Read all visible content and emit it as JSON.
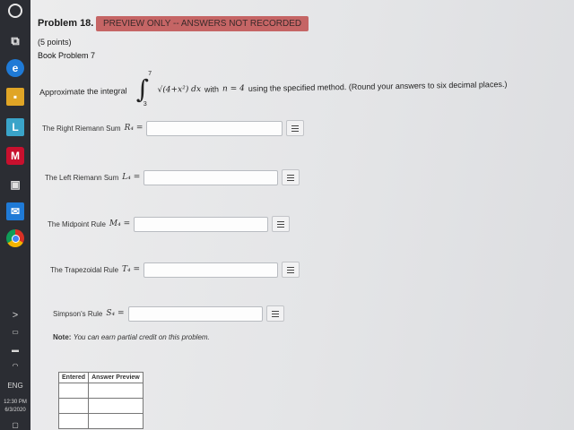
{
  "taskbar": {
    "lang": "ENG",
    "time": "12:30 PM",
    "date": "6/3/2020",
    "arrow": ">"
  },
  "problem": {
    "title": "Problem 18.",
    "badge": "PREVIEW ONLY -- ANSWERS NOT RECORDED",
    "points": "(5 points)",
    "book": "Book Problem 7",
    "intro": "Approximate the integral",
    "upper": "7",
    "lower": "3",
    "integrand": "√(4+x²) dx",
    "with_text": "with",
    "n_expr": "n = 4",
    "instructions": "using the specified method. (Round your answers to six decimal places.)"
  },
  "rules": [
    {
      "label": "The Right Riemann Sum",
      "sym": "R₄ ="
    },
    {
      "label": "The Left Riemann Sum",
      "sym": "L₄ ="
    },
    {
      "label": "The Midpoint Rule",
      "sym": "M₄ ="
    },
    {
      "label": "The Trapezoidal Rule",
      "sym": "T₄ ="
    },
    {
      "label": "Simpson's Rule",
      "sym": "S₄ ="
    }
  ],
  "note": {
    "prefix": "Note:",
    "text": "You can earn partial credit on this problem."
  },
  "table": {
    "headers": [
      "Entered",
      "Answer Preview"
    ]
  }
}
